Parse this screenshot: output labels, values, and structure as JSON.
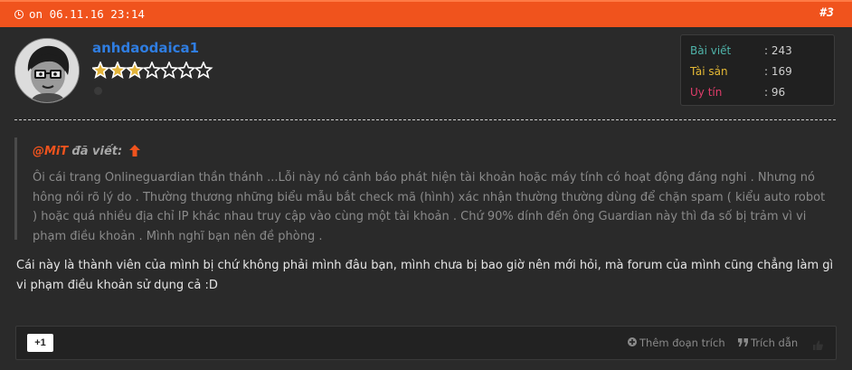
{
  "post": {
    "date_text": "on 06.11.16 23:14",
    "post_number": "#3"
  },
  "user": {
    "name": "anhdaodaica1",
    "stars_filled": 3,
    "stars_total": 7
  },
  "stats": [
    {
      "label": "Bài viết",
      "value": ": 243",
      "color": "#4fb3a9"
    },
    {
      "label": "Tài sản",
      "value": ": 169",
      "color": "#e5b935"
    },
    {
      "label": "Uy tín",
      "value": ": 96",
      "color": "#e23d6b"
    }
  ],
  "quote": {
    "author": "@MiT",
    "said": "đã viết:",
    "text": "Ôi cái trang Onlineguardian thần thánh ...Lỗi này nó cảnh báo phát hiện tài khoản hoặc máy tính có hoạt động đáng nghi . Nhưng nó hông nói rõ lý do . Thường thương những biểu mẫu bắt check mã (hình) xác nhận thường thường dùng để chặn spam ( kiểu auto robot ) hoặc quá nhiều địa chỉ IP khác nhau truy cập vào cùng một tài khoản . Chứ 90% dính đến ông Guardian này thì đa số bị trảm vì vi phạm điều khoản . Mình nghĩ bạn nên đề phòng ."
  },
  "message": "Cái này là thành viên của mình bị chứ không phải mình đâu bạn, mình chưa bị bao giờ nên mới hỏi, mà forum của mình cũng chẳng làm gì vi phạm điều khoản sử dụng cả :D",
  "footer": {
    "plus_one": "+1",
    "add_excerpt": "Thêm đoạn trích",
    "quote_label": "Trích dẫn"
  },
  "colors": {
    "accent": "#f0531d",
    "username": "#2f7de1"
  }
}
